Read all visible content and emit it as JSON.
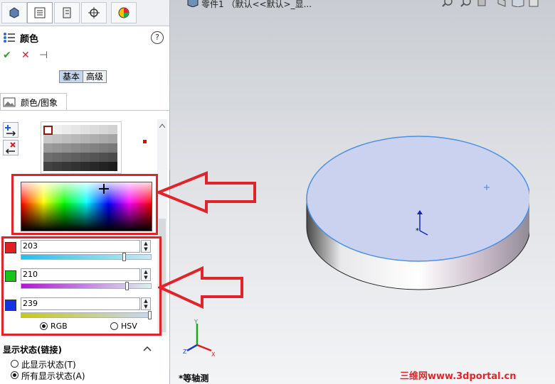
{
  "panel": {
    "title": "颜色",
    "help": "?",
    "ok": "✔",
    "cancel": "✕",
    "pin": "⊣",
    "mode_basic": "基本",
    "mode_advanced": "高级",
    "group_label": "颜色/图象",
    "r_value": "203",
    "g_value": "210",
    "b_value": "239",
    "radio_rgb": "RGB",
    "radio_hsv": "HSV",
    "display_state_title": "显示状态(链接)",
    "display_this": "此显示状态(T)",
    "display_all": "所有显示状态(A)"
  },
  "viewport": {
    "tree_item": "零件1 （默认<<默认>_显...",
    "view_name": "*等轴测"
  },
  "watermark": "三维网www.3dportal.cn",
  "colors": {
    "highlight": "#e0242b",
    "part_top": "#cbd2ef",
    "edge": "#4a90e2"
  }
}
